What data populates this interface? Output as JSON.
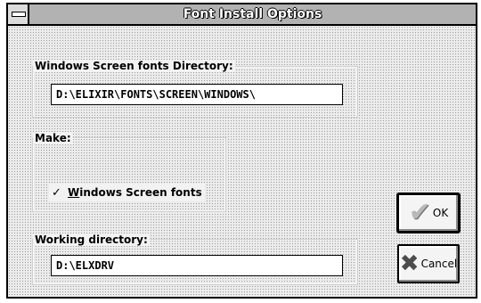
{
  "window": {
    "title": "Font Install Options"
  },
  "screen_fonts": {
    "label": "Windows Screen fonts Directory:",
    "value": "D:\\ELIXIR\\FONTS\\SCREEN\\WINDOWS\\"
  },
  "make": {
    "label": "Make:",
    "option_label": "Windows Screen fonts",
    "option_mnemonic": "W",
    "option_rest": "indows Screen fonts",
    "checked": true
  },
  "working_dir": {
    "label": "Working directory:",
    "value": "D:\\ELXDRV"
  },
  "buttons": {
    "ok_label": "OK",
    "cancel_label": "Cancel"
  },
  "icons": {
    "sysmenu": "system-menu-icon",
    "check": "checkmark-icon",
    "ok": "ok-checkmark-icon",
    "cancel": "cancel-x-icon"
  }
}
